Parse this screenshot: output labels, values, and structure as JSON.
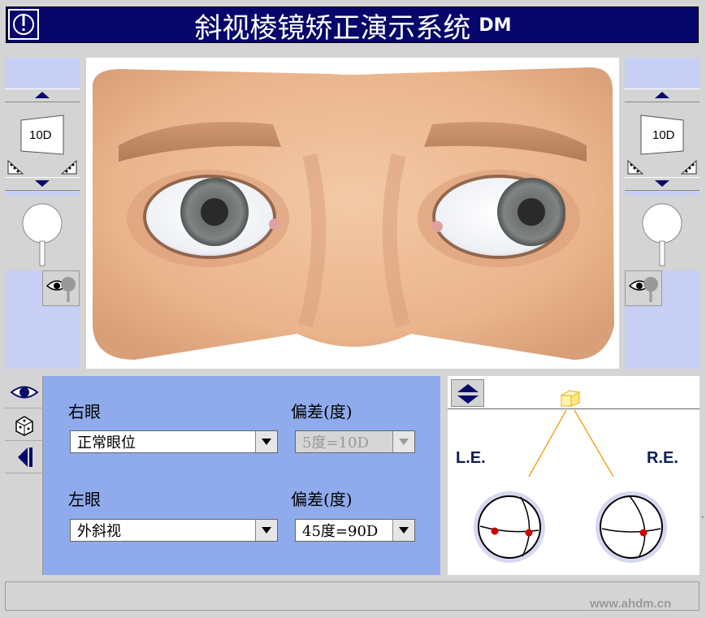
{
  "title": {
    "main": "斜视棱镜矫正演示系统",
    "suffix": "DM"
  },
  "left_prism": {
    "value": "10D"
  },
  "right_prism": {
    "value": "10D"
  },
  "controls": {
    "right_eye_label": "右眼",
    "right_eye_deviation_label": "偏差(度)",
    "right_eye_condition": "正常眼位",
    "right_eye_deviation": "5度=10D",
    "left_eye_label": "左眼",
    "left_eye_deviation_label": "偏差(度)",
    "left_eye_condition": "外斜视",
    "left_eye_deviation": "45度=90D"
  },
  "diagram": {
    "left_label": "L.E.",
    "right_label": "R.E.",
    "edge_mark": "·"
  },
  "watermark": "www.ahdm.cn",
  "colors": {
    "title_bg": "#06066b",
    "panel_blue": "#8fabec",
    "side_blue": "#c7cff4",
    "fix_line": "#f5a623",
    "dot_red": "#cc0000"
  },
  "icons": [
    "info-icon",
    "arrow-up-icon",
    "arrow-down-icon",
    "prism-icon",
    "occluder-icon",
    "eye-icon",
    "dice-icon",
    "collapse-left-icon",
    "dropdown-arrow-icon",
    "toggle-up-down-icon",
    "cube-icon"
  ]
}
